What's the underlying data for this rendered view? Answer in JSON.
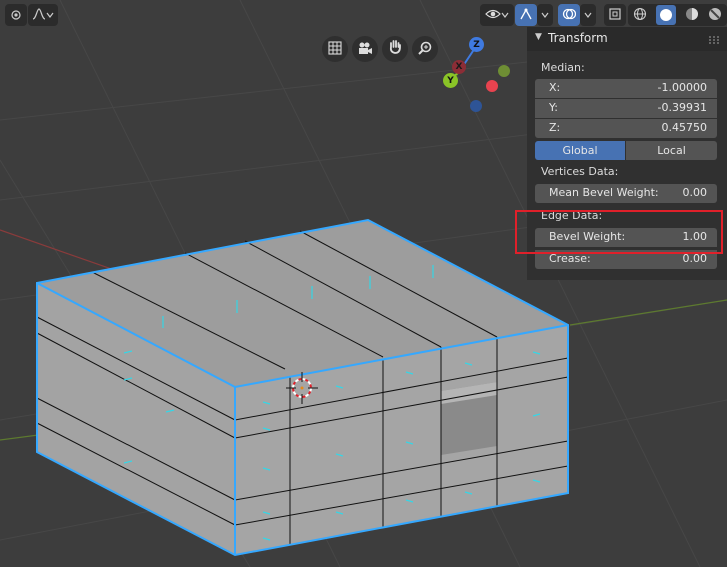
{
  "header": {
    "left_icons": [
      "mode-dot-icon",
      "curve-falloff-icon",
      "chevron-down-icon"
    ],
    "right_icons": [
      "eye-visibility-icon",
      "chevron-down-icon",
      "gizmo-icon",
      "chevron-down-icon",
      "overlay-icon",
      "chevron-down-icon",
      "xray-icon",
      "wireframe-shading-icon",
      "solid-shading-icon",
      "material-shading-icon",
      "rendered-shading-icon"
    ]
  },
  "navigation": {
    "icons": [
      "grid-view-icon",
      "camera-icon",
      "hand-pan-icon",
      "zoom-icon"
    ]
  },
  "gizmo": {
    "z_label": "Z",
    "y_label": "Y",
    "x_label": "X",
    "colors": {
      "x": "#e8434f",
      "y": "#8ac427",
      "z": "#3f7ae0",
      "neg_y": "#6e8e34",
      "neg_z": "#2e5496",
      "neg_x": "#8c2d36"
    }
  },
  "panel": {
    "title": "Transform",
    "median_label": "Median:",
    "x": {
      "label": "X:",
      "value": "-1.00000"
    },
    "y": {
      "label": "Y:",
      "value": "-0.39931"
    },
    "z": {
      "label": "Z:",
      "value": "0.45750"
    },
    "global_label": "Global",
    "local_label": "Local",
    "active_space": "Global",
    "vertices_data_label": "Vertices Data:",
    "mean_bevel_weight": {
      "label": "Mean Bevel Weight:",
      "value": "0.00"
    },
    "edge_data_label": "Edge Data:",
    "bevel_weight": {
      "label": "Bevel Weight:",
      "value": "1.00"
    },
    "crease": {
      "label": "Crease:",
      "value": "0.00"
    }
  },
  "colors": {
    "viewport_bg": "#3d3d3d",
    "panel_bg": "#303030",
    "field_bg": "#545454",
    "accent": "#4772b3",
    "selection_edge": "#35a8ff",
    "annotation": "#e0202a",
    "mesh_face": "#9d9d9d"
  }
}
